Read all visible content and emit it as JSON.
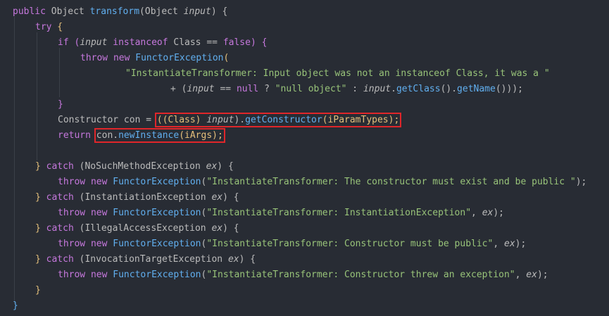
{
  "code": {
    "l1": {
      "kw": "public",
      "t1": " Object ",
      "fn": "transform",
      "p1": "(Object ",
      "arg": "input",
      "p2": ") {"
    },
    "l2": {
      "kw": "try",
      "b": " {"
    },
    "l3": {
      "kw": "if",
      "p1": " (",
      "arg": "input",
      "t1": " instanceof ",
      "t2": "Class",
      "op": " == ",
      "kw2": "false",
      "p2": ") {"
    },
    "l4": {
      "kw": "throw",
      "kw2": " new ",
      "fn": "FunctorException",
      "p": "("
    },
    "l5": {
      "str": "\"InstantiateTransformer: Input object was not an instanceof Class, it was a \""
    },
    "l6": {
      "op": "+ (",
      "arg": "input",
      "t1": " == ",
      "kw": "null",
      "t2": " ? ",
      "str": "\"null object\"",
      "t3": " : ",
      "arg2": "input",
      "t4": ".",
      "fn1": "getClass",
      "t5": "().",
      "fn2": "getName",
      "t6": "()));"
    },
    "l7": {
      "b": "}"
    },
    "l8": {
      "t1": "Constructor con = ",
      "hl_a": "((Class) ",
      "arg": "input",
      "hl_b": ").",
      "fn": "getConstructor",
      "hl_c": "(iParamTypes);"
    },
    "l9": {
      "kw": "return ",
      "hl_a": "con.",
      "fn": "newInstance",
      "hl_b": "(iArgs);"
    },
    "l10": {
      "b": "} ",
      "kw": "catch",
      "p1": " (NoSuchMethodException ",
      "arg": "ex",
      "p2": ") {"
    },
    "l11": {
      "kw": "throw",
      "kw2": " new ",
      "fn": "FunctorException",
      "p1": "(",
      "str": "\"InstantiateTransformer: The constructor must exist and be public \"",
      "p2": ");"
    },
    "l12": {
      "b": "} ",
      "kw": "catch",
      "p1": " (InstantiationException ",
      "arg": "ex",
      "p2": ") {"
    },
    "l13": {
      "kw": "throw",
      "kw2": " new ",
      "fn": "FunctorException",
      "p1": "(",
      "str": "\"InstantiateTransformer: InstantiationException\"",
      "p2": ", ",
      "arg": "ex",
      "p3": ");"
    },
    "l14": {
      "b": "} ",
      "kw": "catch",
      "p1": " (IllegalAccessException ",
      "arg": "ex",
      "p2": ") {"
    },
    "l15": {
      "kw": "throw",
      "kw2": " new ",
      "fn": "FunctorException",
      "p1": "(",
      "str": "\"InstantiateTransformer: Constructor must be public\"",
      "p2": ", ",
      "arg": "ex",
      "p3": ");"
    },
    "l16": {
      "b": "} ",
      "kw": "catch",
      "p1": " (InvocationTargetException ",
      "arg": "ex",
      "p2": ") {"
    },
    "l17": {
      "kw": "throw",
      "kw2": " new ",
      "fn": "FunctorException",
      "p1": "(",
      "str": "\"InstantiateTransformer: Constructor threw an exception\"",
      "p2": ", ",
      "arg": "ex",
      "p3": ");"
    },
    "l18": {
      "b": "}"
    },
    "l19": {
      "b": "}"
    }
  },
  "colors": {
    "background": "#282c34",
    "keyword": "#c678dd",
    "function": "#61afef",
    "string": "#98c379",
    "highlight_box": "#e0262a"
  }
}
